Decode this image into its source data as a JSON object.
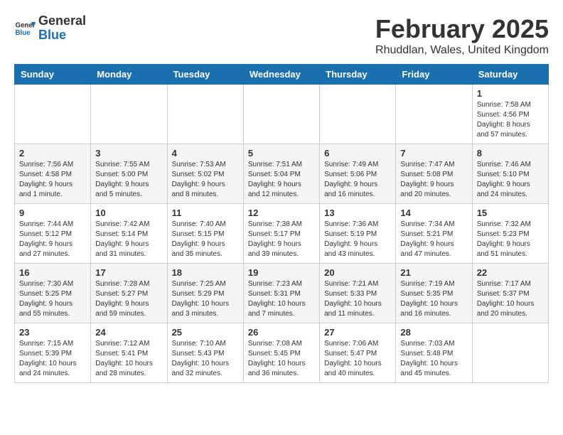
{
  "header": {
    "logo_general": "General",
    "logo_blue": "Blue",
    "month_title": "February 2025",
    "location": "Rhuddlan, Wales, United Kingdom"
  },
  "days_of_week": [
    "Sunday",
    "Monday",
    "Tuesday",
    "Wednesday",
    "Thursday",
    "Friday",
    "Saturday"
  ],
  "weeks": [
    [
      {
        "day": "",
        "info": ""
      },
      {
        "day": "",
        "info": ""
      },
      {
        "day": "",
        "info": ""
      },
      {
        "day": "",
        "info": ""
      },
      {
        "day": "",
        "info": ""
      },
      {
        "day": "",
        "info": ""
      },
      {
        "day": "1",
        "info": "Sunrise: 7:58 AM\nSunset: 4:56 PM\nDaylight: 8 hours\nand 57 minutes."
      }
    ],
    [
      {
        "day": "2",
        "info": "Sunrise: 7:56 AM\nSunset: 4:58 PM\nDaylight: 9 hours\nand 1 minute."
      },
      {
        "day": "3",
        "info": "Sunrise: 7:55 AM\nSunset: 5:00 PM\nDaylight: 9 hours\nand 5 minutes."
      },
      {
        "day": "4",
        "info": "Sunrise: 7:53 AM\nSunset: 5:02 PM\nDaylight: 9 hours\nand 8 minutes."
      },
      {
        "day": "5",
        "info": "Sunrise: 7:51 AM\nSunset: 5:04 PM\nDaylight: 9 hours\nand 12 minutes."
      },
      {
        "day": "6",
        "info": "Sunrise: 7:49 AM\nSunset: 5:06 PM\nDaylight: 9 hours\nand 16 minutes."
      },
      {
        "day": "7",
        "info": "Sunrise: 7:47 AM\nSunset: 5:08 PM\nDaylight: 9 hours\nand 20 minutes."
      },
      {
        "day": "8",
        "info": "Sunrise: 7:46 AM\nSunset: 5:10 PM\nDaylight: 9 hours\nand 24 minutes."
      }
    ],
    [
      {
        "day": "9",
        "info": "Sunrise: 7:44 AM\nSunset: 5:12 PM\nDaylight: 9 hours\nand 27 minutes."
      },
      {
        "day": "10",
        "info": "Sunrise: 7:42 AM\nSunset: 5:14 PM\nDaylight: 9 hours\nand 31 minutes."
      },
      {
        "day": "11",
        "info": "Sunrise: 7:40 AM\nSunset: 5:15 PM\nDaylight: 9 hours\nand 35 minutes."
      },
      {
        "day": "12",
        "info": "Sunrise: 7:38 AM\nSunset: 5:17 PM\nDaylight: 9 hours\nand 39 minutes."
      },
      {
        "day": "13",
        "info": "Sunrise: 7:36 AM\nSunset: 5:19 PM\nDaylight: 9 hours\nand 43 minutes."
      },
      {
        "day": "14",
        "info": "Sunrise: 7:34 AM\nSunset: 5:21 PM\nDaylight: 9 hours\nand 47 minutes."
      },
      {
        "day": "15",
        "info": "Sunrise: 7:32 AM\nSunset: 5:23 PM\nDaylight: 9 hours\nand 51 minutes."
      }
    ],
    [
      {
        "day": "16",
        "info": "Sunrise: 7:30 AM\nSunset: 5:25 PM\nDaylight: 9 hours\nand 55 minutes."
      },
      {
        "day": "17",
        "info": "Sunrise: 7:28 AM\nSunset: 5:27 PM\nDaylight: 9 hours\nand 59 minutes."
      },
      {
        "day": "18",
        "info": "Sunrise: 7:25 AM\nSunset: 5:29 PM\nDaylight: 10 hours\nand 3 minutes."
      },
      {
        "day": "19",
        "info": "Sunrise: 7:23 AM\nSunset: 5:31 PM\nDaylight: 10 hours\nand 7 minutes."
      },
      {
        "day": "20",
        "info": "Sunrise: 7:21 AM\nSunset: 5:33 PM\nDaylight: 10 hours\nand 11 minutes."
      },
      {
        "day": "21",
        "info": "Sunrise: 7:19 AM\nSunset: 5:35 PM\nDaylight: 10 hours\nand 16 minutes."
      },
      {
        "day": "22",
        "info": "Sunrise: 7:17 AM\nSunset: 5:37 PM\nDaylight: 10 hours\nand 20 minutes."
      }
    ],
    [
      {
        "day": "23",
        "info": "Sunrise: 7:15 AM\nSunset: 5:39 PM\nDaylight: 10 hours\nand 24 minutes."
      },
      {
        "day": "24",
        "info": "Sunrise: 7:12 AM\nSunset: 5:41 PM\nDaylight: 10 hours\nand 28 minutes."
      },
      {
        "day": "25",
        "info": "Sunrise: 7:10 AM\nSunset: 5:43 PM\nDaylight: 10 hours\nand 32 minutes."
      },
      {
        "day": "26",
        "info": "Sunrise: 7:08 AM\nSunset: 5:45 PM\nDaylight: 10 hours\nand 36 minutes."
      },
      {
        "day": "27",
        "info": "Sunrise: 7:06 AM\nSunset: 5:47 PM\nDaylight: 10 hours\nand 40 minutes."
      },
      {
        "day": "28",
        "info": "Sunrise: 7:03 AM\nSunset: 5:48 PM\nDaylight: 10 hours\nand 45 minutes."
      },
      {
        "day": "",
        "info": ""
      }
    ]
  ]
}
